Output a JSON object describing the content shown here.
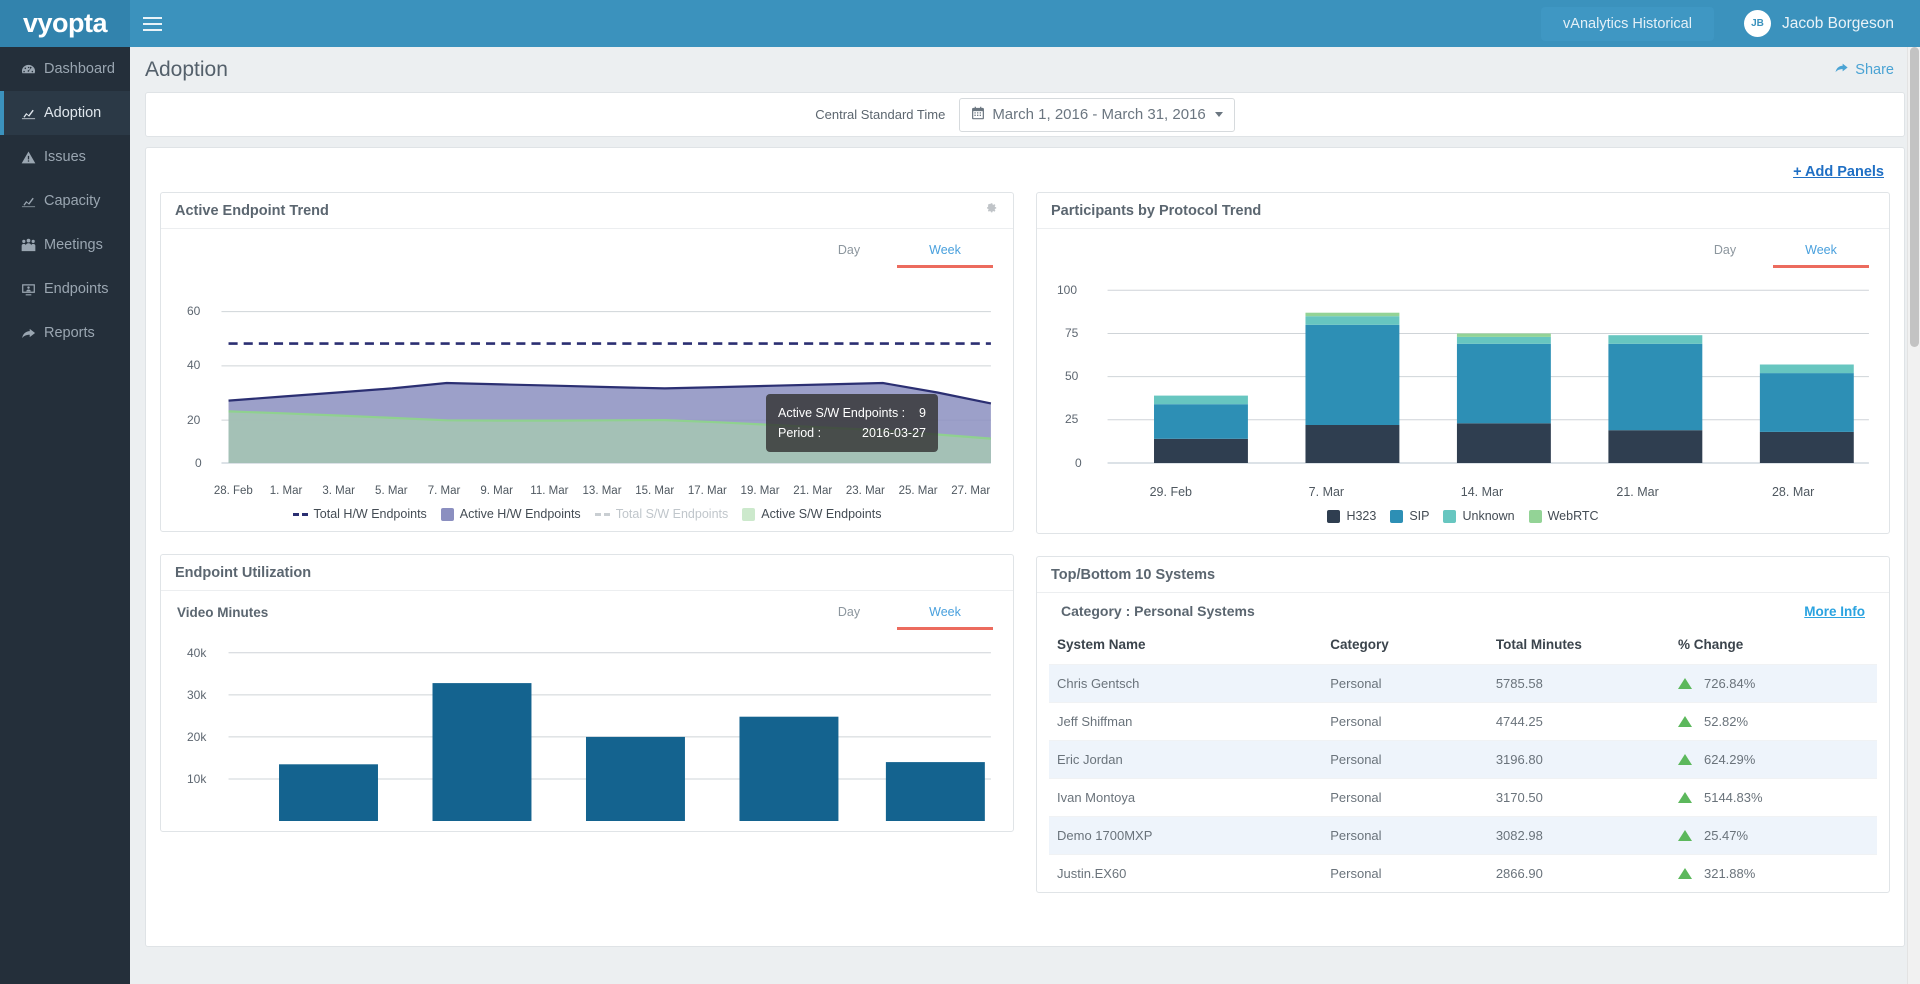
{
  "topbar": {
    "brand": "vyopta",
    "menu_icon": "hamburger-icon",
    "vanalytics_label": "vAnalytics Historical",
    "user_initials": "JB",
    "user_name": "Jacob Borgeson"
  },
  "sidebar": {
    "items": [
      {
        "label": "Dashboard",
        "icon": "dashboard-gauge-icon",
        "active": false
      },
      {
        "label": "Adoption",
        "icon": "chart-line-icon",
        "active": true
      },
      {
        "label": "Issues",
        "icon": "warning-triangle-icon",
        "active": false
      },
      {
        "label": "Capacity",
        "icon": "chart-line-icon",
        "active": false
      },
      {
        "label": "Meetings",
        "icon": "people-group-icon",
        "active": false
      },
      {
        "label": "Endpoints",
        "icon": "monitor-icon",
        "active": false
      },
      {
        "label": "Reports",
        "icon": "share-arrow-icon",
        "active": false
      }
    ]
  },
  "page": {
    "title": "Adoption",
    "share_label": "Share",
    "add_panels_label": "+ Add Panels"
  },
  "daterow": {
    "timezone": "Central Standard Time",
    "range": "March 1, 2016 - March 31, 2016",
    "calendar_icon": "calendar-icon"
  },
  "tabs": {
    "day": "Day",
    "week": "Week"
  },
  "panels": {
    "active_endpoint_trend": {
      "title": "Active Endpoint Trend",
      "gear_icon": "gear-icon",
      "selected_tab": "Week",
      "tooltip": {
        "metric_label": "Active S/W Endpoints :",
        "metric_value": "9",
        "period_label": "Period :",
        "period_value": "2016-03-27"
      }
    },
    "participants_by_protocol": {
      "title": "Participants by Protocol Trend",
      "selected_tab": "Week"
    },
    "endpoint_utilization": {
      "title": "Endpoint Utilization",
      "subtitle": "Video Minutes",
      "selected_tab": "Week"
    },
    "top_bottom_systems": {
      "title": "Top/Bottom 10 Systems",
      "category_label": "Category : Personal Systems",
      "more_info": "More Info",
      "columns": [
        "System Name",
        "Category",
        "Total Minutes",
        "% Change"
      ],
      "rows": [
        {
          "name": "Chris Gentsch",
          "category": "Personal",
          "minutes": "5785.58",
          "change": "726.84%",
          "dir": "up"
        },
        {
          "name": "Jeff Shiffman",
          "category": "Personal",
          "minutes": "4744.25",
          "change": "52.82%",
          "dir": "up"
        },
        {
          "name": "Eric Jordan",
          "category": "Personal",
          "minutes": "3196.80",
          "change": "624.29%",
          "dir": "up"
        },
        {
          "name": "Ivan Montoya",
          "category": "Personal",
          "minutes": "3170.50",
          "change": "5144.83%",
          "dir": "up"
        },
        {
          "name": "Demo 1700MXP",
          "category": "Personal",
          "minutes": "3082.98",
          "change": "25.47%",
          "dir": "up"
        },
        {
          "name": "Justin.EX60",
          "category": "Personal",
          "minutes": "2866.90",
          "change": "321.88%",
          "dir": "up"
        }
      ]
    }
  },
  "colors": {
    "brand_blue": "#3b92bd",
    "sidebar_bg": "#242f3a",
    "accent_underline": "#ec6b5e",
    "tab_active_text": "#49a0dd",
    "h323": "#2f3e50",
    "sip": "#2d8fb5",
    "unknown": "#67c6c0",
    "webrtc": "#93d396",
    "area_hw": "#8b8fc0",
    "area_sw": "#a5c4b4",
    "line_total_hw": "#2b2f72",
    "bar_blue": "#14638f",
    "up_green": "#5cb85c"
  },
  "chart_data": [
    {
      "type": "area",
      "title": "Active Endpoint Trend",
      "xlabel": "",
      "ylabel": "",
      "ylim": [
        0,
        70
      ],
      "yticks": [
        0,
        20,
        40,
        60
      ],
      "grid": true,
      "legend_position": "bottom",
      "categories": [
        "28. Feb",
        "1. Mar",
        "3. Mar",
        "5. Mar",
        "7. Mar",
        "9. Mar",
        "11. Mar",
        "13. Mar",
        "15. Mar",
        "17. Mar",
        "19. Mar",
        "21. Mar",
        "23. Mar",
        "25. Mar",
        "27. Mar"
      ],
      "x": [
        0,
        1,
        2,
        3,
        4,
        5,
        6,
        7,
        8,
        9,
        10,
        11,
        12,
        13,
        14
      ],
      "series": [
        {
          "name": "Total H/W Endpoints",
          "style": "dashed-line",
          "color": "#2b2f72",
          "values": [
            44,
            44,
            44,
            44,
            44,
            44,
            44,
            44,
            44,
            44,
            44,
            44,
            44,
            44,
            44
          ]
        },
        {
          "name": "Active H/W Endpoints",
          "style": "area",
          "color": "#8b8fc0",
          "values": [
            23,
            24.5,
            26,
            27.5,
            29.5,
            29,
            28.5,
            28,
            27.5,
            28,
            28.5,
            29,
            29.5,
            26,
            22
          ]
        },
        {
          "name": "Total S/W Endpoints",
          "style": "dashed-line",
          "color": "#c9ced2",
          "muted": true,
          "values": [
            null,
            null,
            null,
            null,
            null,
            null,
            null,
            null,
            null,
            null,
            null,
            null,
            null,
            null,
            null
          ]
        },
        {
          "name": "Active S/W Endpoints",
          "style": "area",
          "color": "#a5c4b4",
          "values": [
            19,
            18.3,
            17.5,
            16.6,
            15.7,
            15.6,
            15.6,
            15.7,
            15.8,
            15,
            14,
            13,
            12,
            10.5,
            9
          ]
        }
      ]
    },
    {
      "type": "bar",
      "subtype": "stacked",
      "title": "Participants by Protocol Trend",
      "xlabel": "",
      "ylabel": "",
      "ylim": [
        0,
        110
      ],
      "yticks": [
        0,
        25,
        50,
        75,
        100
      ],
      "grid": true,
      "legend_position": "bottom",
      "categories": [
        "29. Feb",
        "7. Mar",
        "14. Mar",
        "21. Mar",
        "28. Mar"
      ],
      "series": [
        {
          "name": "H323",
          "color": "#2f3e50",
          "values": [
            14,
            22,
            23,
            19,
            18
          ]
        },
        {
          "name": "SIP",
          "color": "#2d8fb5",
          "values": [
            20,
            58,
            46,
            50,
            34
          ]
        },
        {
          "name": "Unknown",
          "color": "#67c6c0",
          "values": [
            5,
            5,
            4,
            5,
            5
          ]
        },
        {
          "name": "WebRTC",
          "color": "#93d396",
          "values": [
            0,
            2,
            2,
            0,
            0
          ]
        }
      ],
      "totals": [
        39,
        87,
        75,
        74,
        57
      ]
    },
    {
      "type": "bar",
      "title": "Endpoint Utilization",
      "subtitle": "Video Minutes",
      "xlabel": "",
      "ylabel": "Video Minutes",
      "ylim": [
        0,
        44000
      ],
      "yticks": [
        10000,
        20000,
        30000,
        40000
      ],
      "ytick_labels": [
        "10k",
        "20k",
        "30k",
        "40k"
      ],
      "grid": true,
      "categories": [
        "29. Feb",
        "7. Mar",
        "14. Mar",
        "21. Mar",
        "28. Mar"
      ],
      "values": [
        13500,
        32800,
        20000,
        24800,
        14000
      ],
      "color": "#14638f"
    },
    {
      "type": "table",
      "title": "Top/Bottom 10 Systems",
      "columns": [
        "System Name",
        "Category",
        "Total Minutes",
        "% Change"
      ],
      "rows": [
        [
          "Chris Gentsch",
          "Personal",
          "5785.58",
          "726.84%"
        ],
        [
          "Jeff Shiffman",
          "Personal",
          "4744.25",
          "52.82%"
        ],
        [
          "Eric Jordan",
          "Personal",
          "3196.80",
          "624.29%"
        ],
        [
          "Ivan Montoya",
          "Personal",
          "3170.50",
          "5144.83%"
        ],
        [
          "Demo 1700MXP",
          "Personal",
          "3082.98",
          "25.47%"
        ],
        [
          "Justin.EX60",
          "Personal",
          "2866.90",
          "321.88%"
        ]
      ]
    }
  ]
}
